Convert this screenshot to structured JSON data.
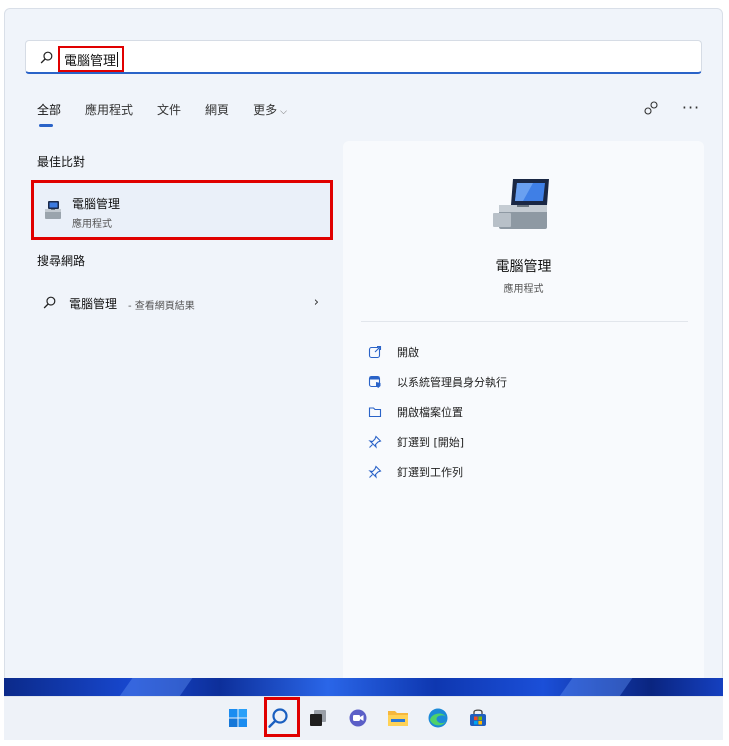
{
  "search": {
    "query": "電腦管理"
  },
  "tabs": [
    {
      "label": "全部",
      "active": true
    },
    {
      "label": "應用程式",
      "active": false
    },
    {
      "label": "文件",
      "active": false
    },
    {
      "label": "網頁",
      "active": false
    },
    {
      "label": "更多",
      "active": false
    }
  ],
  "results": {
    "best_match_heading": "最佳比對",
    "best_match": {
      "title": "電腦管理",
      "subtitle": "應用程式"
    },
    "web_heading": "搜尋網路",
    "web_item": {
      "title": "電腦管理",
      "hint": "- 查看網頁結果"
    }
  },
  "detail": {
    "title": "電腦管理",
    "subtitle": "應用程式",
    "actions": [
      {
        "label": "開啟",
        "icon": "open-icon"
      },
      {
        "label": "以系統管理員身分執行",
        "icon": "run-as-admin-icon"
      },
      {
        "label": "開啟檔案位置",
        "icon": "folder-icon"
      },
      {
        "label": "釘選到 [開始]",
        "icon": "pin-icon"
      },
      {
        "label": "釘選到工作列",
        "icon": "pin-icon"
      }
    ]
  },
  "taskbar": {
    "icons": [
      "start-icon",
      "search-icon",
      "task-view-icon",
      "chat-icon",
      "file-explorer-icon",
      "edge-icon",
      "store-icon"
    ]
  },
  "colors": {
    "accent": "#2a63c8",
    "highlight": "#e00000"
  }
}
